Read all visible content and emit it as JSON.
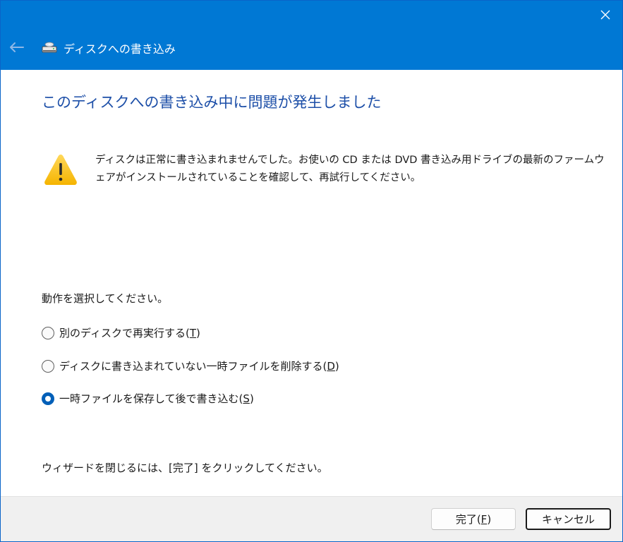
{
  "window": {
    "title": "ディスクへの書き込み"
  },
  "colors": {
    "titlebar": "#0078d4",
    "heading": "#1d4fa8",
    "radio_selected": "#005fb8",
    "footer_bg": "#f0f0f0"
  },
  "icons": {
    "back": "back-arrow-icon",
    "close": "close-icon",
    "drive": "disc-drive-icon",
    "warning": "warning-icon"
  },
  "content": {
    "heading": "このディスクへの書き込み中に問題が発生しました",
    "message": "ディスクは正常に書き込まれませんでした。お使いの CD または DVD 書き込み用ドライブの最新のファームウェアがインストールされていることを確認して、再試行してください。",
    "prompt": "動作を選択してください。",
    "options": [
      {
        "label": "別のディスクで再実行する(",
        "accel": "T",
        "close": ")",
        "selected": false
      },
      {
        "label": "ディスクに書き込まれていない一時ファイルを削除する(",
        "accel": "D",
        "close": ")",
        "selected": false
      },
      {
        "label": "一時ファイルを保存して後で書き込む(",
        "accel": "S",
        "close": ")",
        "selected": true
      }
    ],
    "footer_note": "ウィザードを閉じるには、[完了] をクリックしてください。"
  },
  "buttons": {
    "finish_label": "完了(",
    "finish_accel": "F",
    "finish_close": ")",
    "cancel_label": "キャンセル"
  }
}
